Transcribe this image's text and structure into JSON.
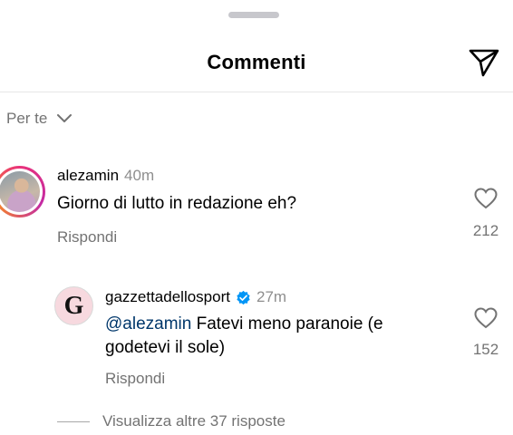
{
  "header": {
    "title": "Commenti"
  },
  "filter": {
    "label": "Per te"
  },
  "comments": [
    {
      "username": "alezamin",
      "time": "40m",
      "text": "Giorno di lutto in redazione eh?",
      "reply_label": "Rispondi",
      "likes": "212"
    }
  ],
  "reply": {
    "username": "gazzettadellosport",
    "verified": true,
    "time": "27m",
    "mention": "@alezamin",
    "text_line1": " Fatevi meno paranoie (e",
    "text_line2": "godetevi il sole)",
    "reply_label": "Rispondi",
    "likes": "152",
    "avatar_letter": "G"
  },
  "more_replies": {
    "label": "Visualizza altre 37 risposte"
  },
  "colors": {
    "mention": "#00376b",
    "verified": "#0095f6",
    "secondary_text": "#737373"
  }
}
